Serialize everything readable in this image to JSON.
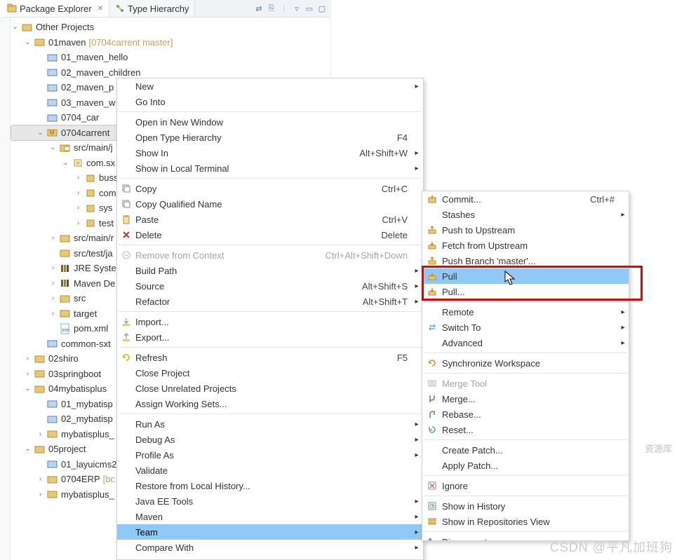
{
  "tabs": {
    "package_explorer": "Package Explorer",
    "type_hierarchy": "Type Hierarchy"
  },
  "tree": {
    "other_projects": "Other Projects",
    "maven01": "01maven",
    "maven01_deco": "[0704carrent master]",
    "maven_hello": "01_maven_hello",
    "maven_children": "02_maven_children",
    "maven_p": "02_maven_p",
    "maven_w": "03_maven_w",
    "car": "0704_car",
    "carrent": "0704carrent",
    "src_main_j": "src/main/j",
    "com_sx": "com.sx",
    "buss": "buss",
    "com": "com",
    "sys": "sys",
    "test": "test",
    "src_main_r": "src/main/r",
    "src_test_ja": "src/test/ja",
    "jre": "JRE Syster",
    "maven_de": "Maven De",
    "src": "src",
    "target": "target",
    "pom": "pom.xml",
    "common_sxt": "common-sxt",
    "shiro": "02shiro",
    "springboot": "03springboot",
    "mybatisplus": "04mybatisplus",
    "my01": "01_mybatisp",
    "my02": "02_mybatisp",
    "myplus": "mybatisplus_",
    "project05": "05project",
    "layuicms": "01_layuicms2",
    "erp": "0704ERP",
    "erp_deco": "[bc",
    "myplus2": "mybatisplus_"
  },
  "menu": {
    "new": "New",
    "go_into": "Go Into",
    "open_new_window": "Open in New Window",
    "open_type_hierarchy": "Open Type Hierarchy",
    "show_in": "Show In",
    "show_local_terminal": "Show in Local Terminal",
    "copy": "Copy",
    "copy_qname": "Copy Qualified Name",
    "paste": "Paste",
    "delete": "Delete",
    "remove_ctx": "Remove from Context",
    "build_path": "Build Path",
    "source": "Source",
    "refactor": "Refactor",
    "import": "Import...",
    "export": "Export...",
    "refresh": "Refresh",
    "close_project": "Close Project",
    "close_unrelated": "Close Unrelated Projects",
    "assign_ws": "Assign Working Sets...",
    "run_as": "Run As",
    "debug_as": "Debug As",
    "profile_as": "Profile As",
    "validate": "Validate",
    "restore_history": "Restore from Local History...",
    "javaee": "Java EE Tools",
    "maven": "Maven",
    "team": "Team",
    "compare_with": "Compare With",
    "sc": {
      "f4": "F4",
      "show_in": "Alt+Shift+W",
      "ctrlc": "Ctrl+C",
      "ctrlv": "Ctrl+V",
      "delete": "Delete",
      "remove_ctx": "Ctrl+Alt+Shift+Down",
      "source": "Alt+Shift+S",
      "refactor": "Alt+Shift+T",
      "f5": "F5"
    }
  },
  "submenu": {
    "commit": "Commit...",
    "commit_sc": "Ctrl+#",
    "stashes": "Stashes",
    "push_upstream": "Push to Upstream",
    "fetch_upstream": "Fetch from Upstream",
    "push_branch": "Push Branch 'master'...",
    "pull": "Pull",
    "pull_dots": "Pull...",
    "remote": "Remote",
    "switch_to": "Switch To",
    "advanced": "Advanced",
    "sync_ws": "Synchronize Workspace",
    "merge_tool": "Merge Tool",
    "merge": "Merge...",
    "rebase": "Rebase...",
    "reset": "Reset...",
    "create_patch": "Create Patch...",
    "apply_patch": "Apply Patch...",
    "ignore": "Ignore",
    "show_history": "Show in History",
    "show_repos": "Show in Repositories View",
    "disconnect": "Disconnect"
  },
  "rightpane_tag": "资源库",
  "watermark": "CSDN @平凡加班狗"
}
